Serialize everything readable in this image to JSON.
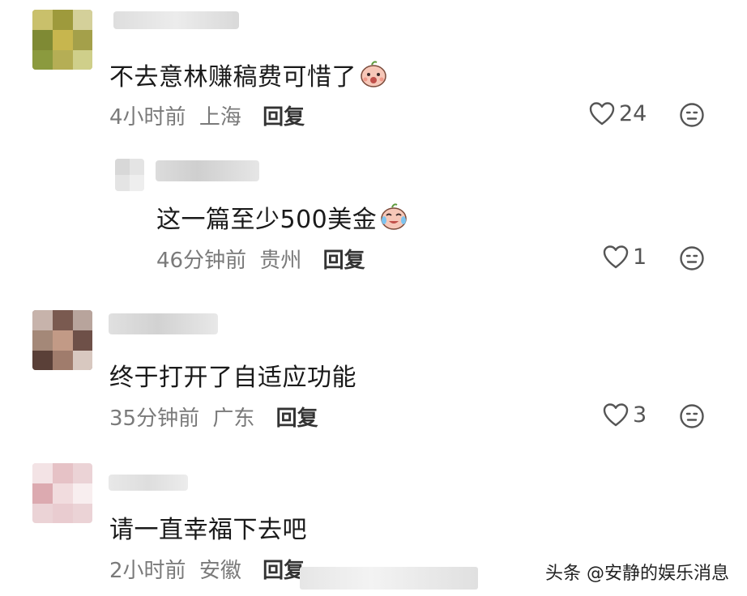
{
  "comments": [
    {
      "text": "不去意林赚稿费可惜了",
      "emoji": "surprised-peach-emoji",
      "time": "4小时前",
      "location": "上海",
      "reply_label": "回复",
      "likes": "24",
      "avatar_color": "#a8a443"
    },
    {
      "text": "这一篇至少500美金",
      "emoji": "crying-laughing-emoji",
      "time": "46分钟前",
      "location": "贵州",
      "reply_label": "回复",
      "likes": "1",
      "avatar_color": "#e2e2e2"
    },
    {
      "text": "终于打开了自适应功能",
      "time": "35分钟前",
      "location": "广东",
      "reply_label": "回复",
      "likes": "3",
      "avatar_color": "#8f6f63"
    },
    {
      "text": "请一直幸福下去吧",
      "time": "2小时前",
      "location": "安徽",
      "reply_label": "回复",
      "avatar_color": "#e8c8cc"
    }
  ],
  "icons": {
    "like": "heart-outline-icon",
    "emoji_reaction": "neutral-face-icon"
  },
  "watermark": "头条 @安静的娱乐消息"
}
